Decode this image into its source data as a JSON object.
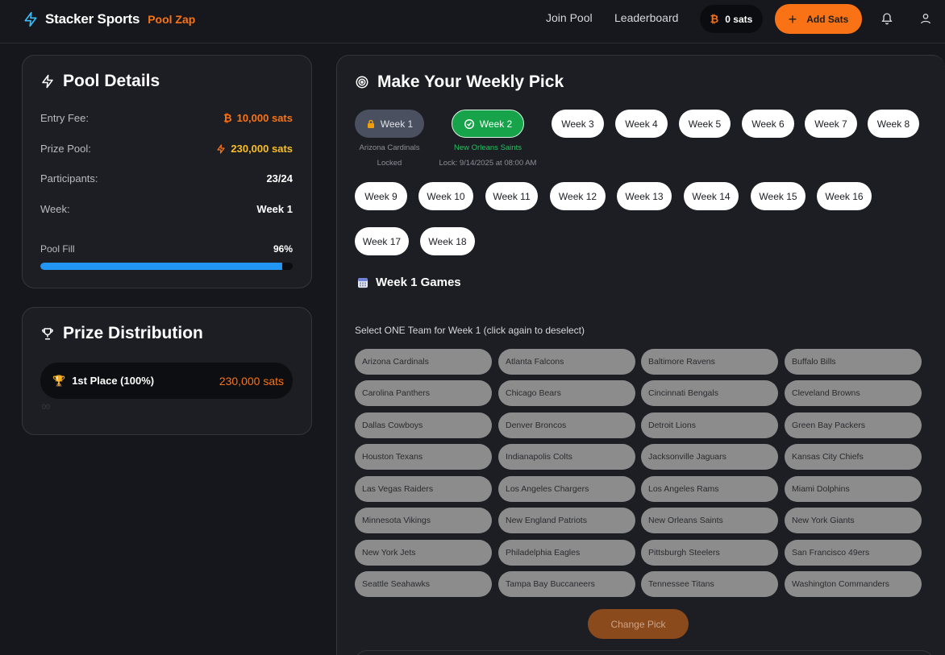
{
  "header": {
    "brand_name": "Stacker Sports",
    "brand_sub": "Pool Zap",
    "nav": [
      "Join Pool",
      "Leaderboard"
    ],
    "wallet_balance": "0 sats",
    "add_sats_label": "Add Sats"
  },
  "pool_details": {
    "title": "Pool Details",
    "rows": [
      {
        "label": "Entry Fee:",
        "value": "10,000 sats"
      },
      {
        "label": "Prize Pool:",
        "value": "230,000 sats"
      },
      {
        "label": "Participants:",
        "value": "23/24"
      },
      {
        "label": "Week:",
        "value": "Week 1"
      }
    ],
    "fill_label": "Pool Fill",
    "fill_value": "96%",
    "fill_fraction": 0.96
  },
  "prize_distribution": {
    "title": "Prize Distribution",
    "place": "1st Place (100%)",
    "amount": "230,000 sats",
    "faint_text": "00"
  },
  "weekly_pick": {
    "title": "Make Your Weekly Pick",
    "weeks": [
      "Week 1",
      "Week 2",
      "Week 3",
      "Week 4",
      "Week 5",
      "Week 6",
      "Week 7",
      "Week 8",
      "Week 9",
      "Week 10",
      "Week 11",
      "Week 12",
      "Week 13",
      "Week 14",
      "Week 15",
      "Week 16",
      "Week 17",
      "Week 18"
    ],
    "week1_team": "Arizona Cardinals",
    "week1_status": "Locked",
    "week2_team": "New Orleans Saints",
    "week2_lock": "Lock: 9/14/2025 at 08:00 AM",
    "games_title": "Week 1 Games",
    "select_hint": "Select ONE Team for Week 1 (click again to deselect)",
    "teams": [
      "Arizona Cardinals",
      "Atlanta Falcons",
      "Baltimore Ravens",
      "Buffalo Bills",
      "Carolina Panthers",
      "Chicago Bears",
      "Cincinnati Bengals",
      "Cleveland Browns",
      "Dallas Cowboys",
      "Denver Broncos",
      "Detroit Lions",
      "Green Bay Packers",
      "Houston Texans",
      "Indianapolis Colts",
      "Jacksonville Jaguars",
      "Kansas City Chiefs",
      "Las Vegas Raiders",
      "Los Angeles Chargers",
      "Los Angeles Rams",
      "Miami Dolphins",
      "Minnesota Vikings",
      "New England Patriots",
      "New Orleans Saints",
      "New York Giants",
      "New York Jets",
      "Philadelphia Eagles",
      "Pittsburgh Steelers",
      "San Francisco 49ers",
      "Seattle Seahawks",
      "Tampa Bay Buccaneers",
      "Tennessee Titans",
      "Washington Commanders"
    ],
    "change_pick_label": "Change Pick"
  },
  "colors": {
    "accent": "#f97316",
    "success": "#16a34a",
    "progress": "#2196f3",
    "prize_pool": "#fbbf24"
  }
}
